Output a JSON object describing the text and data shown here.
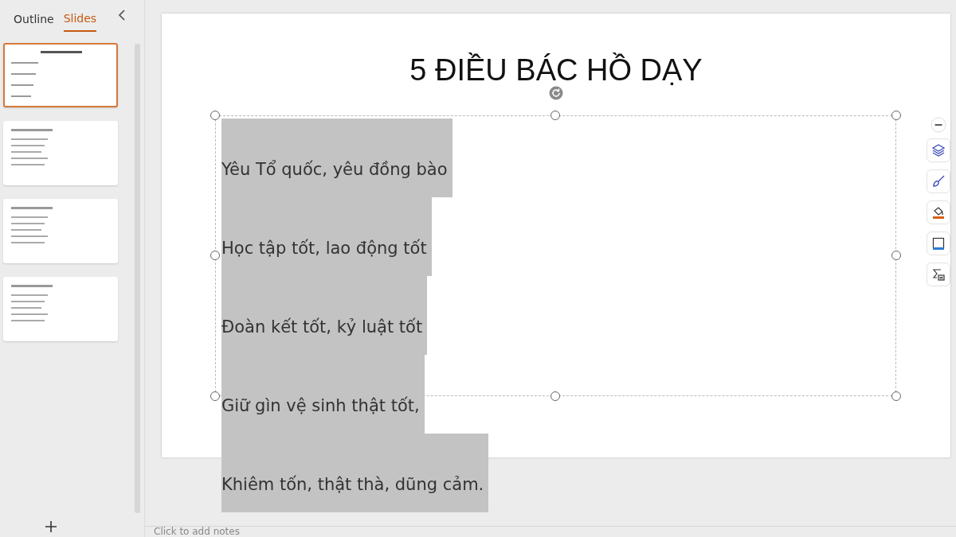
{
  "panel": {
    "tabs": [
      {
        "label": "Outline",
        "selected": false
      },
      {
        "label": "Slides",
        "selected": true
      }
    ],
    "thumbnails": [
      {
        "kind": "centered",
        "selected": true
      },
      {
        "kind": "list",
        "selected": false
      },
      {
        "kind": "list",
        "selected": false
      },
      {
        "kind": "list",
        "selected": false
      }
    ]
  },
  "slide": {
    "title": "5 ĐIỀU BÁC HỒ DẠY",
    "lines": [
      "Yêu Tổ quốc, yêu đồng bào",
      "Học tập tốt, lao động tốt",
      "Đoàn kết tốt, kỷ luật tốt",
      "Giữ gìn vệ sinh thật tốt,",
      "Khiêm tốn, thật thà, dũng cảm."
    ]
  },
  "notes": {
    "placeholder": "Click to add notes"
  }
}
